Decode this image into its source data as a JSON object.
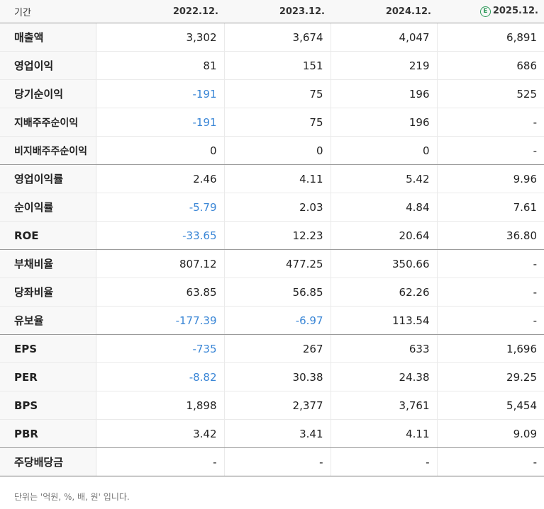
{
  "header": {
    "period_label": "기간",
    "years": [
      "2022.12.",
      "2023.12.",
      "2024.12.",
      "2025.12."
    ],
    "estimate_icon_text": "E",
    "estimate_icon_color": "#2e9a5a"
  },
  "colors": {
    "negative": "#3a86d6",
    "text": "#222222",
    "header_bg": "#f8f8f8"
  },
  "rows": [
    {
      "label": "매출액",
      "values": [
        "3,302",
        "3,674",
        "4,047",
        "6,891"
      ]
    },
    {
      "label": "영업이익",
      "values": [
        "81",
        "151",
        "219",
        "686"
      ]
    },
    {
      "label": "당기순이익",
      "values": [
        "-191",
        "75",
        "196",
        "525"
      ]
    },
    {
      "label": "지배주주순이익",
      "values": [
        "-191",
        "75",
        "196",
        "-"
      ]
    },
    {
      "label": "비지배주주순이익",
      "values": [
        "0",
        "0",
        "0",
        "-"
      ]
    },
    {
      "label": "영업이익률",
      "values": [
        "2.46",
        "4.11",
        "5.42",
        "9.96"
      ]
    },
    {
      "label": "순이익률",
      "values": [
        "-5.79",
        "2.03",
        "4.84",
        "7.61"
      ]
    },
    {
      "label": "ROE",
      "values": [
        "-33.65",
        "12.23",
        "20.64",
        "36.80"
      ]
    },
    {
      "label": "부채비율",
      "values": [
        "807.12",
        "477.25",
        "350.66",
        "-"
      ]
    },
    {
      "label": "당좌비율",
      "values": [
        "63.85",
        "56.85",
        "62.26",
        "-"
      ]
    },
    {
      "label": "유보율",
      "values": [
        "-177.39",
        "-6.97",
        "113.54",
        "-"
      ]
    },
    {
      "label": "EPS",
      "values": [
        "-735",
        "267",
        "633",
        "1,696"
      ]
    },
    {
      "label": "PER",
      "values": [
        "-8.82",
        "30.38",
        "24.38",
        "29.25"
      ]
    },
    {
      "label": "BPS",
      "values": [
        "1,898",
        "2,377",
        "3,761",
        "5,454"
      ]
    },
    {
      "label": "PBR",
      "values": [
        "3.42",
        "3.41",
        "4.11",
        "9.09"
      ]
    },
    {
      "label": "주당배당금",
      "values": [
        "-",
        "-",
        "-",
        "-"
      ]
    }
  ],
  "footnote": "단위는 '억원, %, 배, 원' 입니다."
}
